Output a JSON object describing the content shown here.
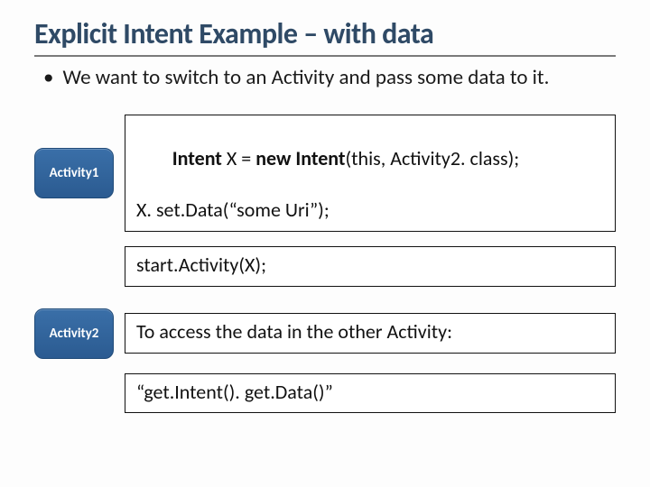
{
  "title": "Explicit Intent Example – with data",
  "bullet": "We want to switch to an Activity and pass some data to it.",
  "activity1_label": "Activity1",
  "activity2_label": "Activity2",
  "code1_prefix1": "Intent",
  "code1_mid1": " X = ",
  "code1_prefix2": "new Intent",
  "code1_rest1": "(this, Activity2. class);",
  "code1_line2": "X. set.Data(“some Uri”);",
  "code2": "start.Activity(X);",
  "code3": "To access the data in the other Activity:",
  "code4": "“get.Intent(). get.Data()”"
}
